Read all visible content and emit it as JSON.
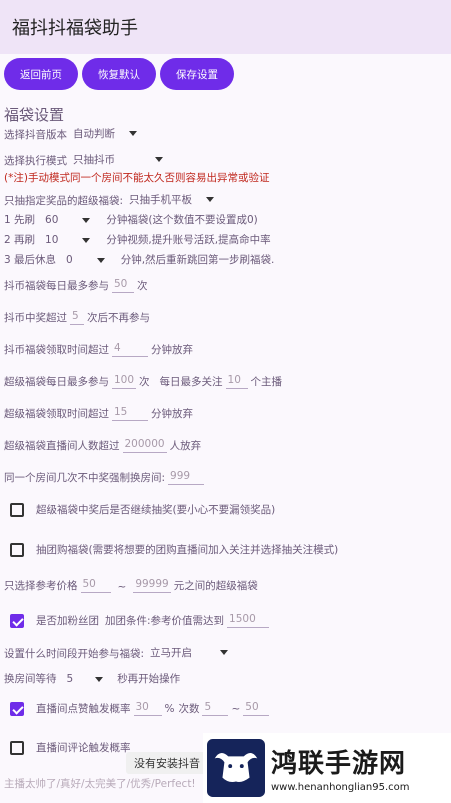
{
  "app": {
    "title": "福抖抖福袋助手"
  },
  "buttons": {
    "back": "返回前页",
    "reset": "恢复默认",
    "save": "保存设置"
  },
  "section_title": "福袋设置",
  "settings": {
    "douyin_version": {
      "label": "选择抖音版本",
      "value": "自动判断"
    },
    "exec_mode": {
      "label": "选择执行模式",
      "value": "只抽抖币"
    },
    "manual_warning": "(*注)手动模式同一个房间不能太久否则容易出异常或验证",
    "super_bag_prize": {
      "label": "只抽指定奖品的超级福袋:",
      "value": "只抽手机平板"
    },
    "step1": {
      "prefix": "1 先刷",
      "value": "60",
      "suffix": "分钟福袋(这个数值不要设置成0)"
    },
    "step2": {
      "prefix": "2 再刷",
      "value": "10",
      "suffix": "分钟视频,提升账号活跃,提高命中率"
    },
    "step3": {
      "prefix": "3 最后休息",
      "value": "0",
      "suffix": "分钟,然后重新跳回第一步刷福袋."
    },
    "coin_daily": {
      "label": "抖币福袋每日最多参与",
      "value": "50",
      "unit": "次"
    },
    "coin_win": {
      "label": "抖币中奖超过",
      "value": "5",
      "unit": "次后不再参与"
    },
    "coin_time": {
      "label": "抖币福袋领取时间超过",
      "value": "4",
      "unit": "分钟放弃"
    },
    "super_daily": {
      "label": "超级福袋每日最多参与",
      "value": "100",
      "unit": "次",
      "follow_label": "每日最多关注",
      "follow_value": "10",
      "follow_unit": "个主播"
    },
    "super_time": {
      "label": "超级福袋领取时间超过",
      "value": "15",
      "unit": "分钟放弃"
    },
    "super_people": {
      "label": "超级福袋直播间人数超过",
      "value": "200000",
      "unit": "人放弃"
    },
    "same_room": {
      "label": "同一个房间几次不中奖强制换房间:",
      "value": "999"
    },
    "continue_after_win": {
      "label": "超级福袋中奖后是否继续抽奖(要小心不要漏领奖品)",
      "checked": false
    },
    "group_buy": {
      "label": "抽团购福袋(需要将想要的团购直播间加入关注并选择抽关注模式)",
      "checked": false
    },
    "price_range": {
      "label": "只选择参考价格",
      "min": "50",
      "tilde": "~",
      "max": "99999",
      "unit": "元之间的超级福袋"
    },
    "fan_group": {
      "label": "是否加粉丝团",
      "cond": "加团条件:参考价值需达到",
      "value": "1500",
      "checked": true
    },
    "start_time": {
      "label": "设置什么时间段开始参与福袋:",
      "value": "立马开启"
    },
    "wait": {
      "label": "换房间等待",
      "value": "5",
      "unit": "秒再开始操作"
    },
    "like": {
      "label": "直播间点赞触发概率",
      "value": "30",
      "pct": "%",
      "count_label": "次数",
      "min": "5",
      "tilde": "~",
      "max": "50",
      "checked": true
    },
    "comment": {
      "label": "直播间评论触发概率",
      "checked": false
    },
    "comment_text": "主播太帅了/真好/太完美了/优秀/Perfect!"
  },
  "toast": "没有安装抖音",
  "watermark": {
    "name": "鸿联手游网",
    "url": "www.henanhonglian95.com"
  },
  "colors": {
    "accent": "#6f2ce9",
    "appbar": "#efe4f7",
    "warning": "#c0281e"
  }
}
